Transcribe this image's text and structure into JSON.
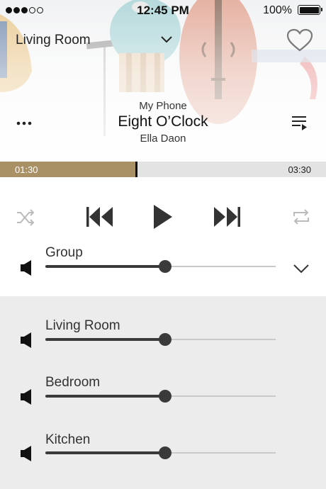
{
  "status_bar": {
    "signal_dots_filled": 3,
    "signal_dots_total": 5,
    "time": "12:45 PM",
    "battery_percent": "100%",
    "battery_level": 1.0
  },
  "header": {
    "room_name": "Living Room",
    "favorite_icon": "heart-outline-icon",
    "dropdown_icon": "chevron-down-icon"
  },
  "now_playing": {
    "source": "My Phone",
    "title": "Eight O’Clock",
    "artist": "Ella Daon",
    "more_icon": "more-dots-icon",
    "queue_icon": "playlist-icon"
  },
  "progress": {
    "elapsed": "01:30",
    "duration": "03:30",
    "fraction": 0.418,
    "played_color": "#a99065"
  },
  "transport": {
    "shuffle_icon": "shuffle-icon",
    "previous_icon": "skip-previous-icon",
    "play_icon": "play-icon",
    "next_icon": "skip-next-icon",
    "repeat_icon": "repeat-icon"
  },
  "group_volume": {
    "label": "Group",
    "level": 0.52,
    "expand_icon": "chevron-down-icon"
  },
  "room_volumes": [
    {
      "label": "Living Room",
      "level": 0.52
    },
    {
      "label": "Bedroom",
      "level": 0.52
    },
    {
      "label": "Kitchen",
      "level": 0.52
    }
  ]
}
